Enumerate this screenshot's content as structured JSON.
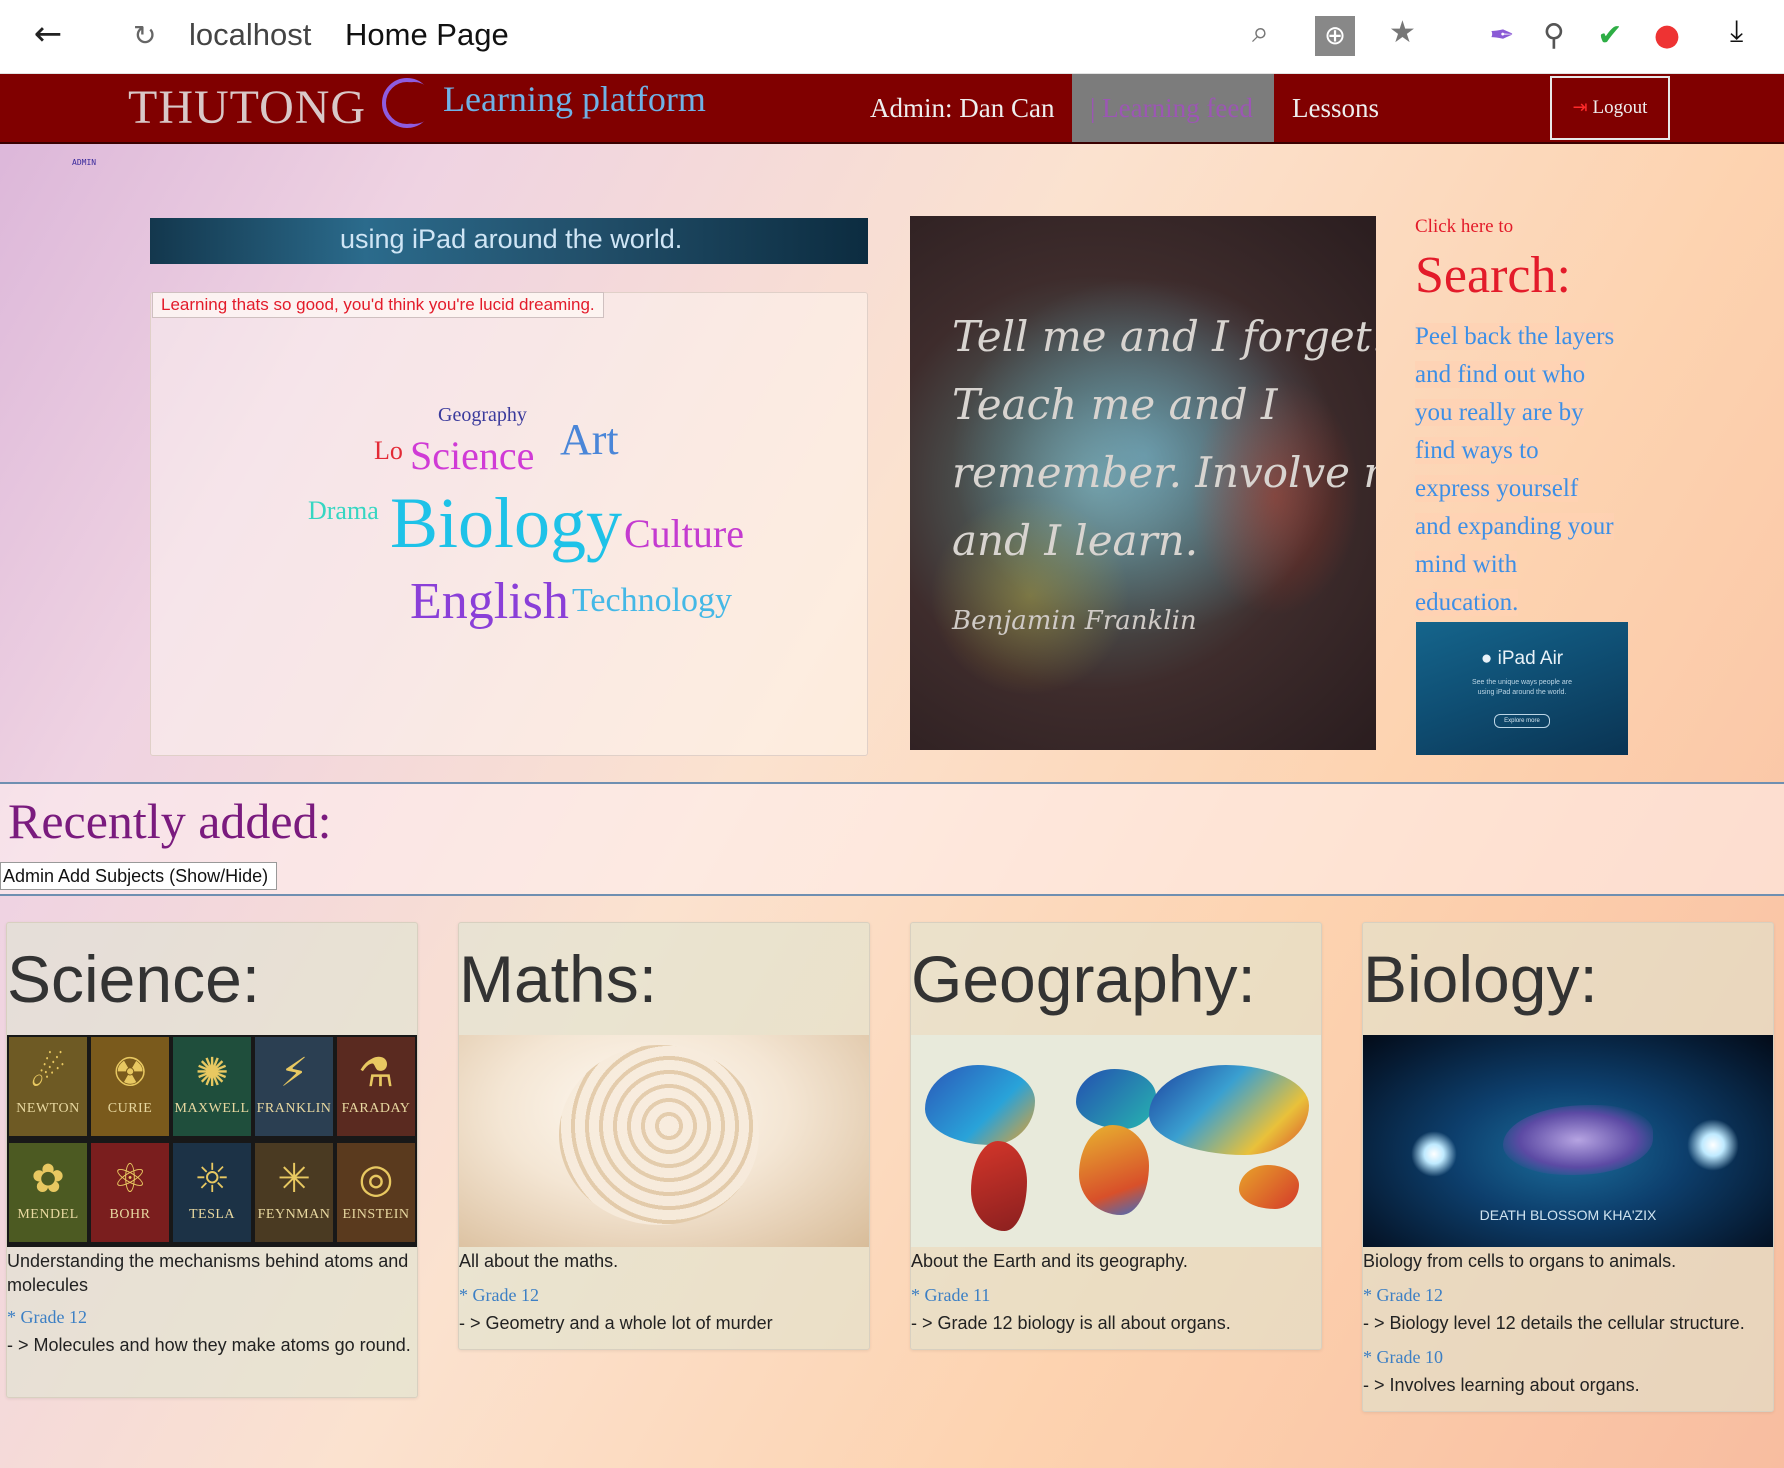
{
  "browser": {
    "host": "localhost",
    "page_title": "Home Page"
  },
  "nav": {
    "brand": "THUTONG",
    "brand_sub": "Learning platform",
    "admin": "Admin: Dan Can",
    "learning_feed": "| Learning feed",
    "lessons": "Lessons",
    "logout": "Logout"
  },
  "tiny_label": "ADMIN",
  "banner_text": "using iPad around the world.",
  "tagline": "Learning thats so good, you'd think you're lucid dreaming.",
  "word_cloud": [
    "Geography",
    "Art",
    "Lo",
    "Science",
    "Drama",
    "Biology",
    "Culture",
    "English",
    "Technology"
  ],
  "quote": {
    "lines": [
      "Tell me and I forget.",
      "Teach me and I",
      "remember. Involve me",
      "and I learn."
    ],
    "author": "Benjamin Franklin"
  },
  "search": {
    "click_here": "Click here to",
    "heading": "Search:",
    "desc_lines": [
      "Peel back the layers",
      "and find out who",
      "you really are by",
      "find ways to",
      "express yourself",
      "and expanding your",
      "mind with",
      "education."
    ]
  },
  "ipad_ad": {
    "title": "iPad Air",
    "sub1": "See the unique ways people are",
    "sub2": "using iPad around the world.",
    "cta": "Explore more"
  },
  "recent": {
    "heading": "Recently added:",
    "toggle": "Admin Add Subjects (Show/Hide)"
  },
  "science_tiles": [
    "NEWTON",
    "CURIE",
    "MAXWELL",
    "FRANKLIN",
    "FARADAY",
    "MENDEL",
    "BOHR",
    "TESLA",
    "FEYNMAN",
    "EINSTEIN"
  ],
  "cards": [
    {
      "title": "Science:",
      "desc": "Understanding the mechanisms behind atoms and molecules",
      "grades": [
        {
          "grade": "* Grade 12",
          "note": "- > Molecules and how they make atoms go round."
        }
      ]
    },
    {
      "title": "Maths:",
      "desc": "All about the maths.",
      "grades": [
        {
          "grade": "* Grade 12",
          "note": "- > Geometry and a whole lot of murder"
        }
      ]
    },
    {
      "title": "Geography:",
      "desc": "About the Earth and its geography.",
      "grades": [
        {
          "grade": "* Grade 11",
          "note": "- > Grade 12 biology is all about organs."
        }
      ]
    },
    {
      "title": "Biology:",
      "desc": "Biology from cells to organs to animals.",
      "image_caption": "DEATH BLOSSOM KHA'ZIX",
      "grades": [
        {
          "grade": "* Grade 12",
          "note": "- > Biology level 12 details the cellular structure."
        },
        {
          "grade": "* Grade 10",
          "note": "- > Involves learning about organs."
        }
      ]
    }
  ],
  "colors": {
    "navbar": "#800000",
    "accent_red": "#e31b2a",
    "link_blue": "#3c7fc4",
    "heading_purple": "#7a1b7e"
  }
}
